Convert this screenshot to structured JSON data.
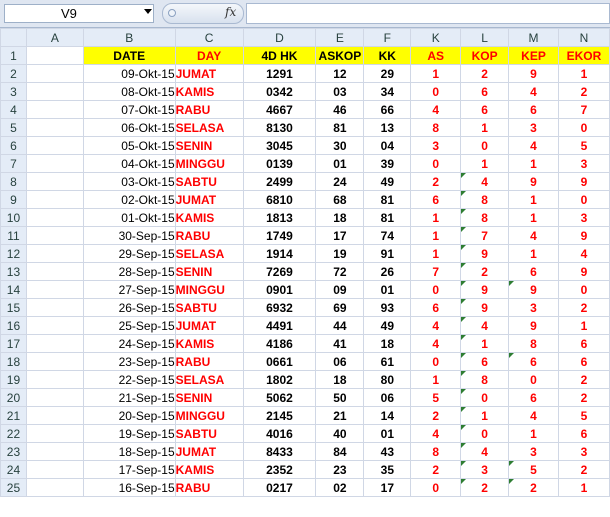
{
  "formula_bar": {
    "name_box": "V9",
    "fx_label": "fx",
    "formula": ""
  },
  "columns": [
    "A",
    "B",
    "C",
    "D",
    "E",
    "F",
    "K",
    "L",
    "M",
    "N"
  ],
  "headers": [
    "DATE",
    "DAY",
    "4D HK",
    "ASKOP",
    "KK",
    "AS",
    "KOP",
    "KEP",
    "EKOR"
  ],
  "rows": [
    {
      "n": "2",
      "date": "09-Okt-15",
      "day": "JUMAT",
      "hk": "1291",
      "askop": "12",
      "kk": "29",
      "as": "1",
      "kop": "2",
      "kep": "9",
      "ekor": "1"
    },
    {
      "n": "3",
      "date": "08-Okt-15",
      "day": "KAMIS",
      "hk": "0342",
      "askop": "03",
      "kk": "34",
      "as": "0",
      "kop": "6",
      "kep": "4",
      "ekor": "2"
    },
    {
      "n": "4",
      "date": "07-Okt-15",
      "day": "RABU",
      "hk": "4667",
      "askop": "46",
      "kk": "66",
      "as": "4",
      "kop": "6",
      "kep": "6",
      "ekor": "7"
    },
    {
      "n": "5",
      "date": "06-Okt-15",
      "day": "SELASA",
      "hk": "8130",
      "askop": "81",
      "kk": "13",
      "as": "8",
      "kop": "1",
      "kep": "3",
      "ekor": "0"
    },
    {
      "n": "6",
      "date": "05-Okt-15",
      "day": "SENIN",
      "hk": "3045",
      "askop": "30",
      "kk": "04",
      "as": "3",
      "kop": "0",
      "kep": "4",
      "ekor": "5"
    },
    {
      "n": "7",
      "date": "04-Okt-15",
      "day": "MINGGU",
      "hk": "0139",
      "askop": "01",
      "kk": "39",
      "as": "0",
      "kop": "1",
      "kep": "1",
      "ekor": "3"
    },
    {
      "n": "8",
      "date": "03-Okt-15",
      "day": "SABTU",
      "hk": "2499",
      "askop": "24",
      "kk": "49",
      "as": "2",
      "kop": "4",
      "kep": "9",
      "ekor": "9"
    },
    {
      "n": "9",
      "date": "02-Okt-15",
      "day": "JUMAT",
      "hk": "6810",
      "askop": "68",
      "kk": "81",
      "as": "6",
      "kop": "8",
      "kep": "1",
      "ekor": "0"
    },
    {
      "n": "10",
      "date": "01-Okt-15",
      "day": "KAMIS",
      "hk": "1813",
      "askop": "18",
      "kk": "81",
      "as": "1",
      "kop": "8",
      "kep": "1",
      "ekor": "3"
    },
    {
      "n": "11",
      "date": "30-Sep-15",
      "day": "RABU",
      "hk": "1749",
      "askop": "17",
      "kk": "74",
      "as": "1",
      "kop": "7",
      "kep": "4",
      "ekor": "9"
    },
    {
      "n": "12",
      "date": "29-Sep-15",
      "day": "SELASA",
      "hk": "1914",
      "askop": "19",
      "kk": "91",
      "as": "1",
      "kop": "9",
      "kep": "1",
      "ekor": "4"
    },
    {
      "n": "13",
      "date": "28-Sep-15",
      "day": "SENIN",
      "hk": "7269",
      "askop": "72",
      "kk": "26",
      "as": "7",
      "kop": "2",
      "kep": "6",
      "ekor": "9"
    },
    {
      "n": "14",
      "date": "27-Sep-15",
      "day": "MINGGU",
      "hk": "0901",
      "askop": "09",
      "kk": "01",
      "as": "0",
      "kop": "9",
      "kep": "9",
      "ekor": "0"
    },
    {
      "n": "15",
      "date": "26-Sep-15",
      "day": "SABTU",
      "hk": "6932",
      "askop": "69",
      "kk": "93",
      "as": "6",
      "kop": "9",
      "kep": "3",
      "ekor": "2"
    },
    {
      "n": "16",
      "date": "25-Sep-15",
      "day": "JUMAT",
      "hk": "4491",
      "askop": "44",
      "kk": "49",
      "as": "4",
      "kop": "4",
      "kep": "9",
      "ekor": "1"
    },
    {
      "n": "17",
      "date": "24-Sep-15",
      "day": "KAMIS",
      "hk": "4186",
      "askop": "41",
      "kk": "18",
      "as": "4",
      "kop": "1",
      "kep": "8",
      "ekor": "6"
    },
    {
      "n": "18",
      "date": "23-Sep-15",
      "day": "RABU",
      "hk": "0661",
      "askop": "06",
      "kk": "61",
      "as": "0",
      "kop": "6",
      "kep": "6",
      "ekor": "6"
    },
    {
      "n": "19",
      "date": "22-Sep-15",
      "day": "SELASA",
      "hk": "1802",
      "askop": "18",
      "kk": "80",
      "as": "1",
      "kop": "8",
      "kep": "0",
      "ekor": "2"
    },
    {
      "n": "20",
      "date": "21-Sep-15",
      "day": "SENIN",
      "hk": "5062",
      "askop": "50",
      "kk": "06",
      "as": "5",
      "kop": "0",
      "kep": "6",
      "ekor": "2"
    },
    {
      "n": "21",
      "date": "20-Sep-15",
      "day": "MINGGU",
      "hk": "2145",
      "askop": "21",
      "kk": "14",
      "as": "2",
      "kop": "1",
      "kep": "4",
      "ekor": "5"
    },
    {
      "n": "22",
      "date": "19-Sep-15",
      "day": "SABTU",
      "hk": "4016",
      "askop": "40",
      "kk": "01",
      "as": "4",
      "kop": "0",
      "kep": "1",
      "ekor": "6"
    },
    {
      "n": "23",
      "date": "18-Sep-15",
      "day": "JUMAT",
      "hk": "8433",
      "askop": "84",
      "kk": "43",
      "as": "8",
      "kop": "4",
      "kep": "3",
      "ekor": "3"
    },
    {
      "n": "24",
      "date": "17-Sep-15",
      "day": "KAMIS",
      "hk": "2352",
      "askop": "23",
      "kk": "35",
      "as": "2",
      "kop": "3",
      "kep": "5",
      "ekor": "2"
    },
    {
      "n": "25",
      "date": "16-Sep-15",
      "day": "RABU",
      "hk": "0217",
      "askop": "02",
      "kk": "17",
      "as": "0",
      "kop": "2",
      "kep": "2",
      "ekor": "1"
    }
  ]
}
